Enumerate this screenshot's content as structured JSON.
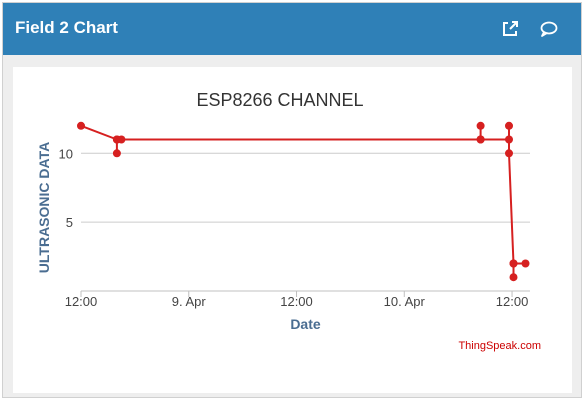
{
  "widget": {
    "title": "Field 2 Chart",
    "icons": [
      "external-link-icon",
      "comment-icon"
    ]
  },
  "colors": {
    "header": "#2f80b7",
    "series": "#d62020",
    "axis_label": "#4a6d91",
    "credit": "#cc0000"
  },
  "chart_data": {
    "type": "line",
    "title": "ESP8266 CHANNEL",
    "xlabel": "Date",
    "ylabel": "ULTRASONIC DATA",
    "x_tick_labels": [
      "12:00",
      "9. Apr",
      "12:00",
      "10. Apr",
      "12:00"
    ],
    "y_tick_labels": [
      "5",
      "10"
    ],
    "ylim": [
      0,
      13
    ],
    "grid": true,
    "legend": "none",
    "series": [
      {
        "points": [
          {
            "x": "2016-04-08 12:00",
            "y": 12
          },
          {
            "x": "2016-04-08 16:00",
            "y": 11
          },
          {
            "x": "2016-04-08 16:00",
            "y": 10
          },
          {
            "x": "2016-04-08 16:00",
            "y": 11
          },
          {
            "x": "2016-04-08 16:30",
            "y": 11
          },
          {
            "x": "2016-04-10 08:30",
            "y": 11
          },
          {
            "x": "2016-04-10 08:30",
            "y": 12
          },
          {
            "x": "2016-04-10 08:30",
            "y": 11
          },
          {
            "x": "2016-04-10 11:40",
            "y": 11
          },
          {
            "x": "2016-04-10 11:40",
            "y": 12
          },
          {
            "x": "2016-04-10 11:40",
            "y": 10
          },
          {
            "x": "2016-04-10 12:10",
            "y": 2
          },
          {
            "x": "2016-04-10 12:10",
            "y": 1
          },
          {
            "x": "2016-04-10 12:10",
            "y": 2
          },
          {
            "x": "2016-04-10 13:30",
            "y": 2
          }
        ]
      }
    ]
  },
  "credit": "ThingSpeak.com"
}
